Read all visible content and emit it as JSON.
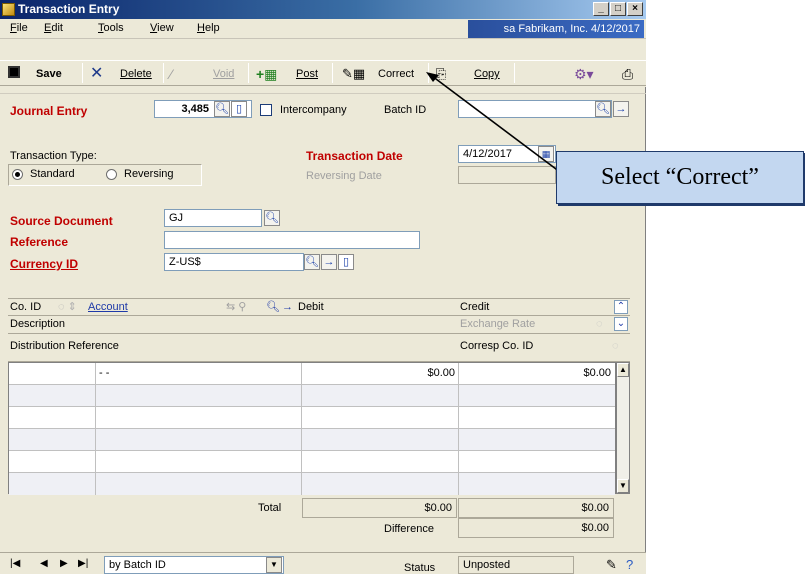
{
  "window": {
    "title": "Transaction Entry",
    "min": "_",
    "max": "□",
    "close": "×"
  },
  "menu": {
    "file": "File",
    "edit": "Edit",
    "tools": "Tools",
    "view": "View",
    "help": "Help"
  },
  "company_banner": "sa  Fabrikam, Inc.  4/12/2017",
  "toolbar": {
    "save": "Save",
    "delete": "Delete",
    "void": "Void",
    "post": "Post",
    "correct": "Correct",
    "copy": "Copy"
  },
  "header": {
    "journal_entry_label": "Journal Entry",
    "journal_entry_value": "3,485",
    "intercompany_label": "Intercompany",
    "batch_id_label": "Batch ID",
    "batch_id_value": "",
    "transaction_type_label": "Transaction Type:",
    "standard_label": "Standard",
    "reversing_label": "Reversing",
    "transaction_date_label": "Transaction Date",
    "transaction_date_value": "4/12/2017",
    "reversing_date_label": "Reversing Date",
    "source_document_label": "Source Document",
    "source_document_value": "GJ",
    "reference_label": "Reference",
    "reference_value": "",
    "currency_id_label": "Currency ID",
    "currency_id_value": "Z-US$"
  },
  "grid": {
    "col_coid": "Co. ID",
    "col_account": "Account",
    "col_debit": "Debit",
    "col_credit": "Credit",
    "col_description": "Description",
    "col_exchange_rate": "Exchange Rate",
    "col_distribution_reference": "Distribution Reference",
    "col_corresp_coid": "Corresp Co. ID",
    "rows": [
      {
        "account": "-          -",
        "debit": "$0.00",
        "credit": "$0.00"
      }
    ]
  },
  "totals": {
    "total_label": "Total",
    "total_debit": "$0.00",
    "total_credit": "$0.00",
    "difference_label": "Difference",
    "difference_value": "$0.00"
  },
  "footer": {
    "sort_value": "by Batch ID",
    "status_label": "Status",
    "status_value": "Unposted"
  },
  "callout": {
    "text": "Select “Correct”"
  }
}
